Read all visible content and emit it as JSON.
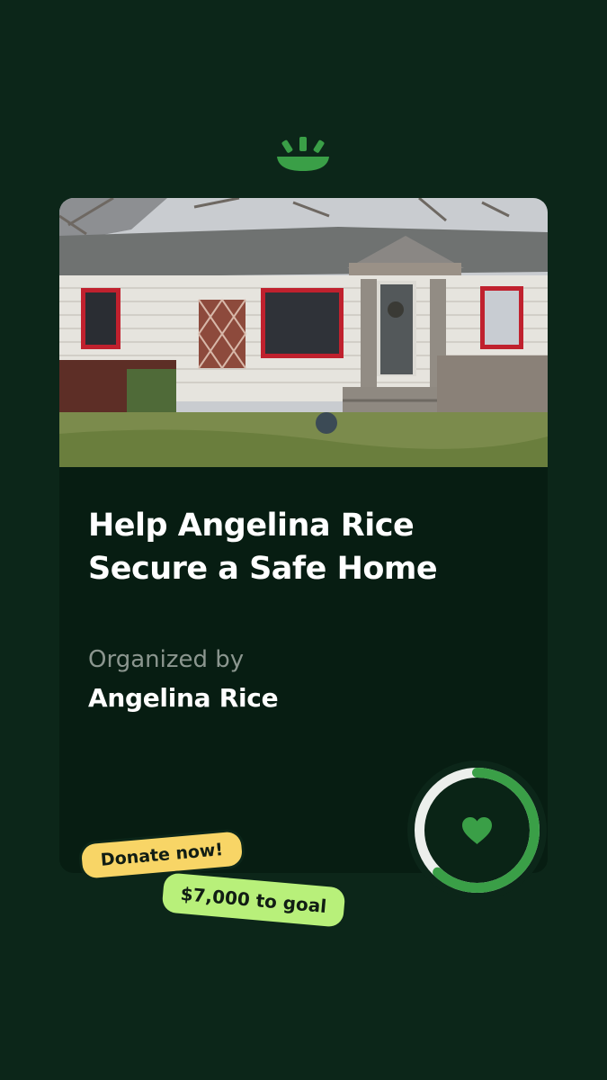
{
  "brand": {
    "logo_icon": "sunrise-logo-icon",
    "accent_color": "#3a9f47"
  },
  "campaign": {
    "image_description": "house-photo",
    "title": "Help Angelina Rice Secure a Safe Home",
    "organizer_label": "Organized by",
    "organizer_name": "Angelina Rice",
    "progress_fraction": 0.62,
    "progress_icon": "heart-icon"
  },
  "badges": {
    "donate_label": "Donate now!",
    "donate_color": "#f8d566",
    "goal_label": "$7,000 to goal",
    "goal_color": "#b8f07a"
  }
}
